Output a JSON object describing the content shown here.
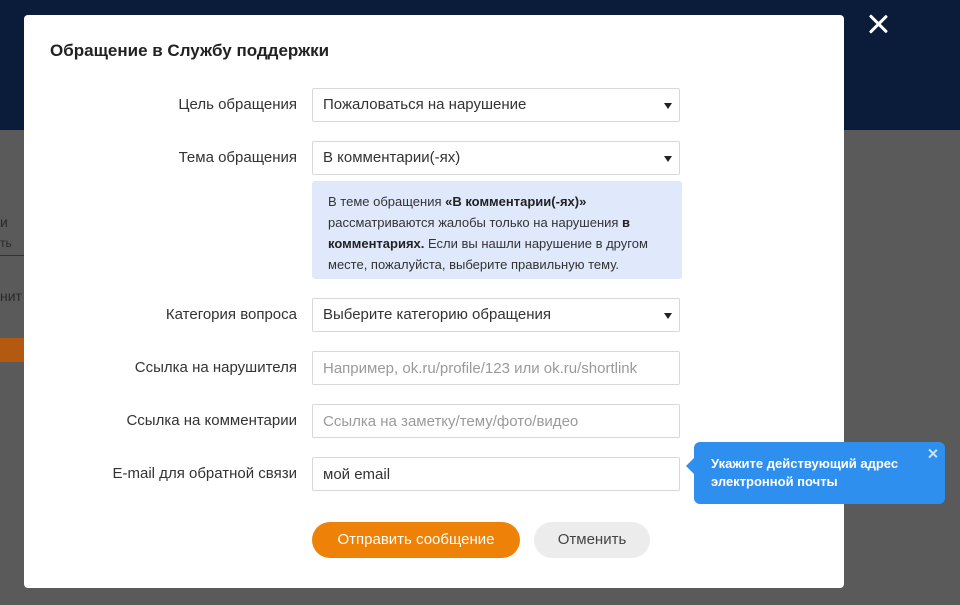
{
  "background": {
    "fragments": [
      "и",
      "ть",
      "нит"
    ]
  },
  "modal": {
    "title": "Обращение в Службу поддержки",
    "fields": {
      "purpose": {
        "label": "Цель обращения",
        "value": "Пожаловаться на нарушение"
      },
      "topic": {
        "label": "Тема обращения",
        "value": "В комментарии(-ях)"
      },
      "category": {
        "label": "Категория вопроса",
        "value": "Выберите категорию обращения"
      },
      "violator_link": {
        "label": "Ссылка на нарушителя",
        "placeholder": "Например, ok.ru/profile/123 или ok.ru/shortlink"
      },
      "comments_link": {
        "label": "Ссылка на комментарии",
        "placeholder": "Ссылка на заметку/тему/фото/видео"
      },
      "email": {
        "label": "E-mail для обратной связи",
        "value": "мой email"
      }
    },
    "info": {
      "part1": "В теме обращения ",
      "bold1": "«В комментарии(-ях)»",
      "part2": " рассматриваются жалобы только на нарушения ",
      "bold2": "в комментариях.",
      "part3": " Если вы нашли нарушение в другом месте, пожалуйста, выберите правильную тему."
    },
    "tooltip": "Укажите действующий адрес электронной почты",
    "buttons": {
      "submit": "Отправить сообщение",
      "cancel": "Отменить"
    }
  },
  "colors": {
    "accent": "#ee8208",
    "tooltip": "#2f8fef",
    "info_bg": "#dfe9fb"
  },
  "icons": {
    "close_modal": "close-icon",
    "close_tooltip": "close-icon",
    "select_caret": "caret-down-icon"
  }
}
